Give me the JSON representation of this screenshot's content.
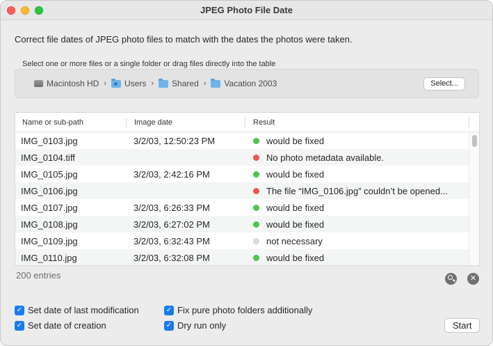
{
  "window": {
    "title": "JPEG Photo File Date"
  },
  "intro": "Correct file dates of JPEG photo files to match with the dates the photos were taken.",
  "select_hint": "Select one or more files or a single folder or drag files directly into the table",
  "path": {
    "crumbs": [
      {
        "label": "Macintosh HD",
        "icon": "hard-drive-icon"
      },
      {
        "label": "Users",
        "icon": "users-folder-icon"
      },
      {
        "label": "Shared",
        "icon": "folder-icon"
      },
      {
        "label": "Vacation 2003",
        "icon": "folder-icon"
      }
    ],
    "separator": "›",
    "select_button": "Select..."
  },
  "table": {
    "columns": [
      "Name or sub-path",
      "Image date",
      "Result"
    ],
    "rows": [
      {
        "name": "IMG_0103.jpg",
        "date": "3/2/03, 12:50:23 PM",
        "status": "green",
        "result": "would be fixed"
      },
      {
        "name": "IMG_0104.tiff",
        "date": "",
        "status": "red",
        "result": "No photo metadata available."
      },
      {
        "name": "IMG_0105.jpg",
        "date": "3/2/03, 2:42:16 PM",
        "status": "green",
        "result": "would be fixed"
      },
      {
        "name": "IMG_0106.jpg",
        "date": "",
        "status": "red",
        "result": "The file “IMG_0106.jpg” couldn’t be opened..."
      },
      {
        "name": "IMG_0107.jpg",
        "date": "3/2/03, 6:26:33 PM",
        "status": "green",
        "result": "would be fixed"
      },
      {
        "name": "IMG_0108.jpg",
        "date": "3/2/03, 6:27:02 PM",
        "status": "green",
        "result": "would be fixed"
      },
      {
        "name": "IMG_0109.jpg",
        "date": "3/2/03, 6:32:43 PM",
        "status": "gray",
        "result": "not necessary"
      },
      {
        "name": "IMG_0110.jpg",
        "date": "3/2/03, 6:32:08 PM",
        "status": "green",
        "result": "would be fixed"
      }
    ]
  },
  "entries": "200 entries",
  "options": {
    "set_modification": "Set date of last modification",
    "set_creation": "Set date of creation",
    "fix_folders": "Fix pure photo folders additionally",
    "dry_run": "Dry run only"
  },
  "start_button": "Start",
  "colors": {
    "accent": "#1a7bf0",
    "green": "#4fc44a",
    "red": "#ea5650",
    "gray": "#dadada"
  }
}
